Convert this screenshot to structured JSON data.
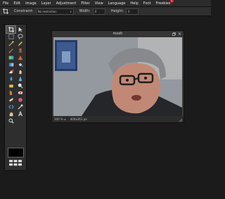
{
  "menu": {
    "items": [
      "File",
      "Edit",
      "Image",
      "Layer",
      "Adjustment",
      "Filter",
      "View",
      "Language",
      "Help",
      "Font",
      "Freebies"
    ],
    "freebies_badge": "1"
  },
  "options": {
    "constraint_label": "Constraint:",
    "constraint_value": "No restriction",
    "width_label": "Width:",
    "width_value": "0",
    "height_label": "Height:",
    "height_value": "0"
  },
  "tools": [
    "crop-icon",
    "move-icon",
    "marquee-icon",
    "lasso-icon",
    "wand-icon",
    "pencil-icon",
    "brush-icon",
    "clone-icon",
    "color-replace-icon",
    "drawing-icon",
    "gradient-icon",
    "fill-icon",
    "eraser-icon",
    "smudge-icon",
    "blur-icon",
    "sharpen-icon",
    "sponge-icon",
    "dodge-icon",
    "burn-icon",
    "redeye-icon",
    "spot-heal-icon",
    "bloat-icon",
    "pinch-icon",
    "colorpicker-icon",
    "type-icon",
    "hand-icon",
    "zoom-icon"
  ],
  "colors": {
    "foreground": "#000000",
    "accent_badge": "#e0202a"
  },
  "document": {
    "title": "mosh",
    "zoom": "100",
    "zoom_unit": "%",
    "dimensions": "400x261 px"
  }
}
